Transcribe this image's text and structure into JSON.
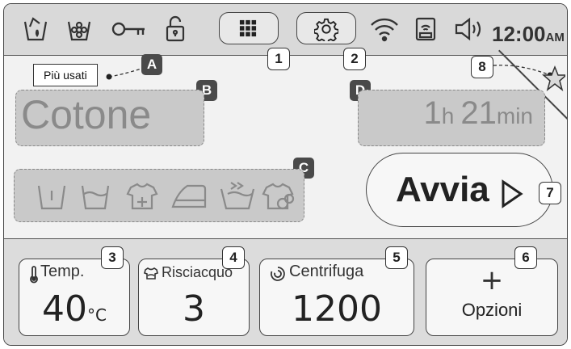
{
  "status_bar": {
    "icons": [
      "detergent-icon",
      "softener-icon",
      "key-icon",
      "unlock-icon"
    ],
    "menu_button_icon": "grid-menu-icon",
    "settings_button_icon": "settings-gear-icon",
    "wifi_icon": "wifi-icon",
    "remote_icon": "remote-control-icon",
    "volume_icon": "volume-icon",
    "time": "12:00",
    "ampm": "AM"
  },
  "callouts": {
    "n1": "1",
    "n2": "2",
    "n3": "3",
    "n4": "4",
    "n5": "5",
    "n6": "6",
    "n7": "7",
    "n8": "8",
    "a": "A",
    "b": "B",
    "c": "C",
    "d": "D"
  },
  "favorites": {
    "label": "Più usati"
  },
  "program": {
    "name": "Cotone"
  },
  "duration": {
    "hours": "1",
    "hours_unit": "h",
    "minutes": "21",
    "minutes_unit": "min"
  },
  "phases": [
    "prewash-icon",
    "wash-icon",
    "soak-icon",
    "iron-icon",
    "quick-rinse-icon",
    "spin-dry-icon"
  ],
  "start": {
    "label": "Avvia"
  },
  "settings": {
    "temp": {
      "label": "Temp.",
      "value": "40",
      "unit": "°C"
    },
    "rinse": {
      "label": "Risciacquo",
      "value": "3"
    },
    "spin": {
      "label": "Centrifuga",
      "value": "1200"
    },
    "options": {
      "symbol": "+",
      "label": "Opzioni"
    }
  },
  "colors": {
    "status_bg": "#d9d9d9",
    "dimmed_box": "#c9c9c9",
    "dimmed_text": "#8a8a8a",
    "badge_dark": "#4a4a4a"
  }
}
